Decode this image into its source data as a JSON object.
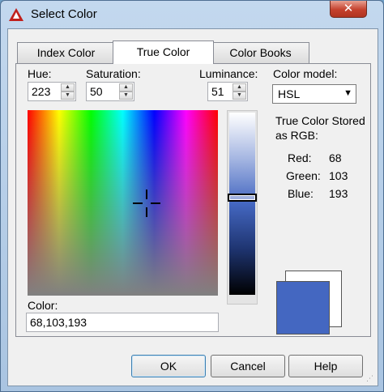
{
  "window": {
    "title": "Select Color",
    "close_label": "✕"
  },
  "tabs": [
    {
      "label": "Index Color"
    },
    {
      "label": "True Color"
    },
    {
      "label": "Color Books"
    }
  ],
  "controls": {
    "hue": {
      "label": "Hue:",
      "value": "223"
    },
    "saturation": {
      "label": "Saturation:",
      "value": "50"
    },
    "luminance": {
      "label": "Luminance:",
      "value": "51"
    },
    "color_model": {
      "label": "Color model:",
      "value": "HSL"
    },
    "color_field": {
      "label": "Color:",
      "value": "68,103,193"
    }
  },
  "rgb_info": {
    "heading_line1": "True Color Stored",
    "heading_line2": "as RGB:",
    "red_label": "Red:",
    "red": "68",
    "green_label": "Green:",
    "green": "103",
    "blue_label": "Blue:",
    "blue": "193"
  },
  "buttons": {
    "ok": "OK",
    "cancel": "Cancel",
    "help": "Help"
  },
  "colors": {
    "current": "#4467c1",
    "previous": "#ffffff",
    "accent": "#3c7fb1"
  },
  "icons": {
    "app": "autocad-triangle-icon",
    "crosshair": "crosshair-icon",
    "spin_up": "up-arrow-icon",
    "spin_down": "down-arrow-icon",
    "dropdown": "chevron-down-icon"
  }
}
